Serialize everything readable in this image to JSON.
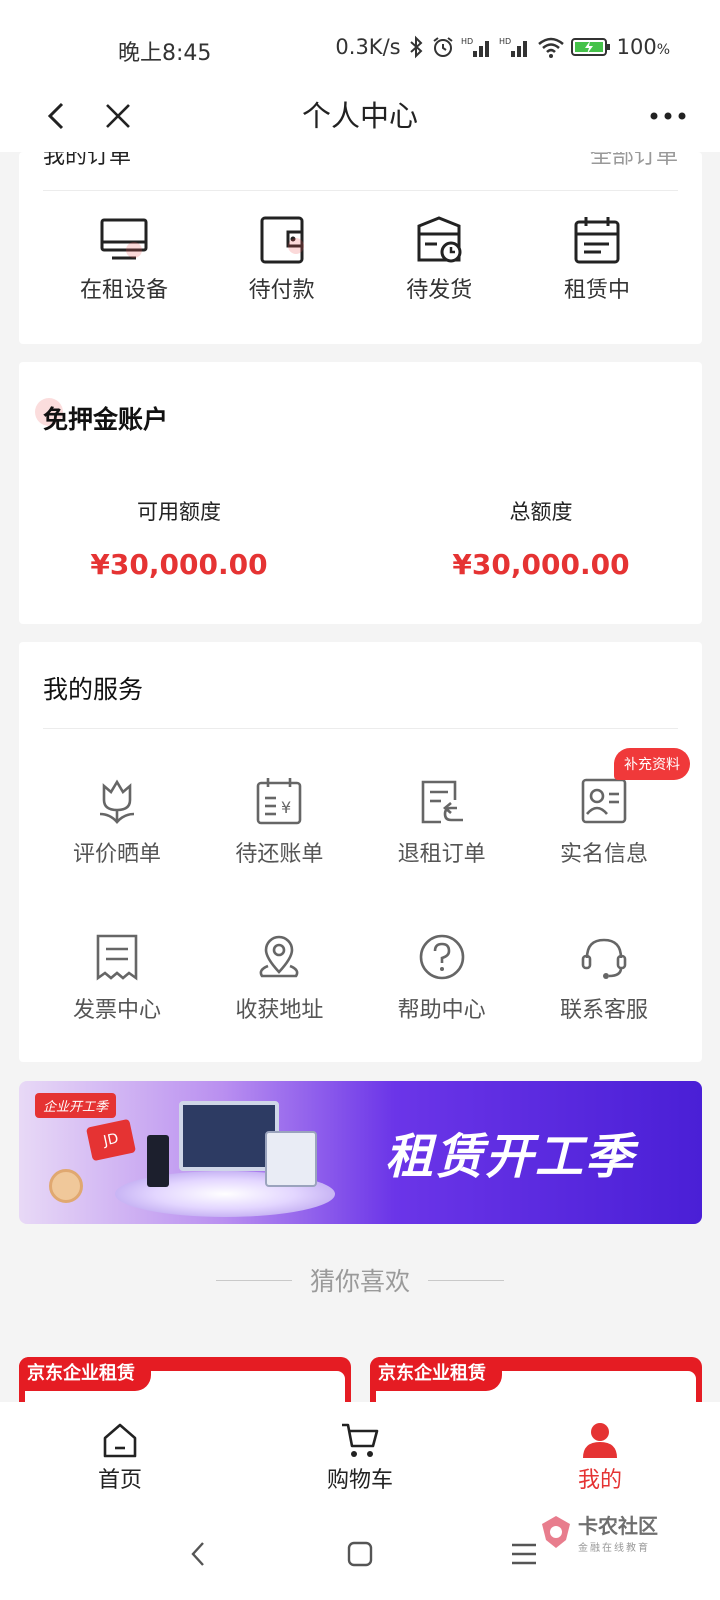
{
  "status_bar": {
    "time": "晚上8:45",
    "net_speed": "0.3K/s",
    "battery": "100",
    "battery_unit": "%"
  },
  "title_bar": {
    "title": "个人中心"
  },
  "orders": {
    "header_left": "我的订单",
    "header_right": "全部订单",
    "items": [
      {
        "label": "在租设备",
        "icon": "monitor-icon"
      },
      {
        "label": "待付款",
        "icon": "wallet-icon"
      },
      {
        "label": "待发货",
        "icon": "package-clock-icon"
      },
      {
        "label": "租赁中",
        "icon": "calendar-icon"
      }
    ]
  },
  "deposit": {
    "title": "免押金账户",
    "available_label": "可用额度",
    "available_value": "¥30,000.00",
    "total_label": "总额度",
    "total_value": "¥30,000.00"
  },
  "services": {
    "title": "我的服务",
    "items": [
      {
        "label": "评价晒单",
        "icon": "tulip-icon"
      },
      {
        "label": "待还账单",
        "icon": "bill-calendar-icon"
      },
      {
        "label": "退租订单",
        "icon": "return-order-icon"
      },
      {
        "label": "实名信息",
        "icon": "id-card-icon",
        "badge": "补充资料"
      },
      {
        "label": "发票中心",
        "icon": "invoice-icon"
      },
      {
        "label": "收获地址",
        "icon": "location-pin-icon"
      },
      {
        "label": "帮助中心",
        "icon": "help-circle-icon"
      },
      {
        "label": "联系客服",
        "icon": "headset-icon"
      }
    ]
  },
  "banner": {
    "tag": "企业开工季",
    "text": "租赁开工季"
  },
  "guess": {
    "text": "猜你喜欢"
  },
  "products": [
    {
      "tag": "京东企业租赁"
    },
    {
      "tag": "京东企业租赁"
    }
  ],
  "bottom_nav": {
    "items": [
      {
        "label": "首页",
        "icon": "home-icon"
      },
      {
        "label": "购物车",
        "icon": "cart-icon"
      },
      {
        "label": "我的",
        "icon": "user-icon",
        "active": true
      }
    ]
  },
  "watermark": {
    "text": "卡农社区",
    "sub": "金融在线教育"
  },
  "colors": {
    "accent": "#e53333",
    "badge": "#f0393a",
    "banner_purple": "#4a1fd6"
  }
}
